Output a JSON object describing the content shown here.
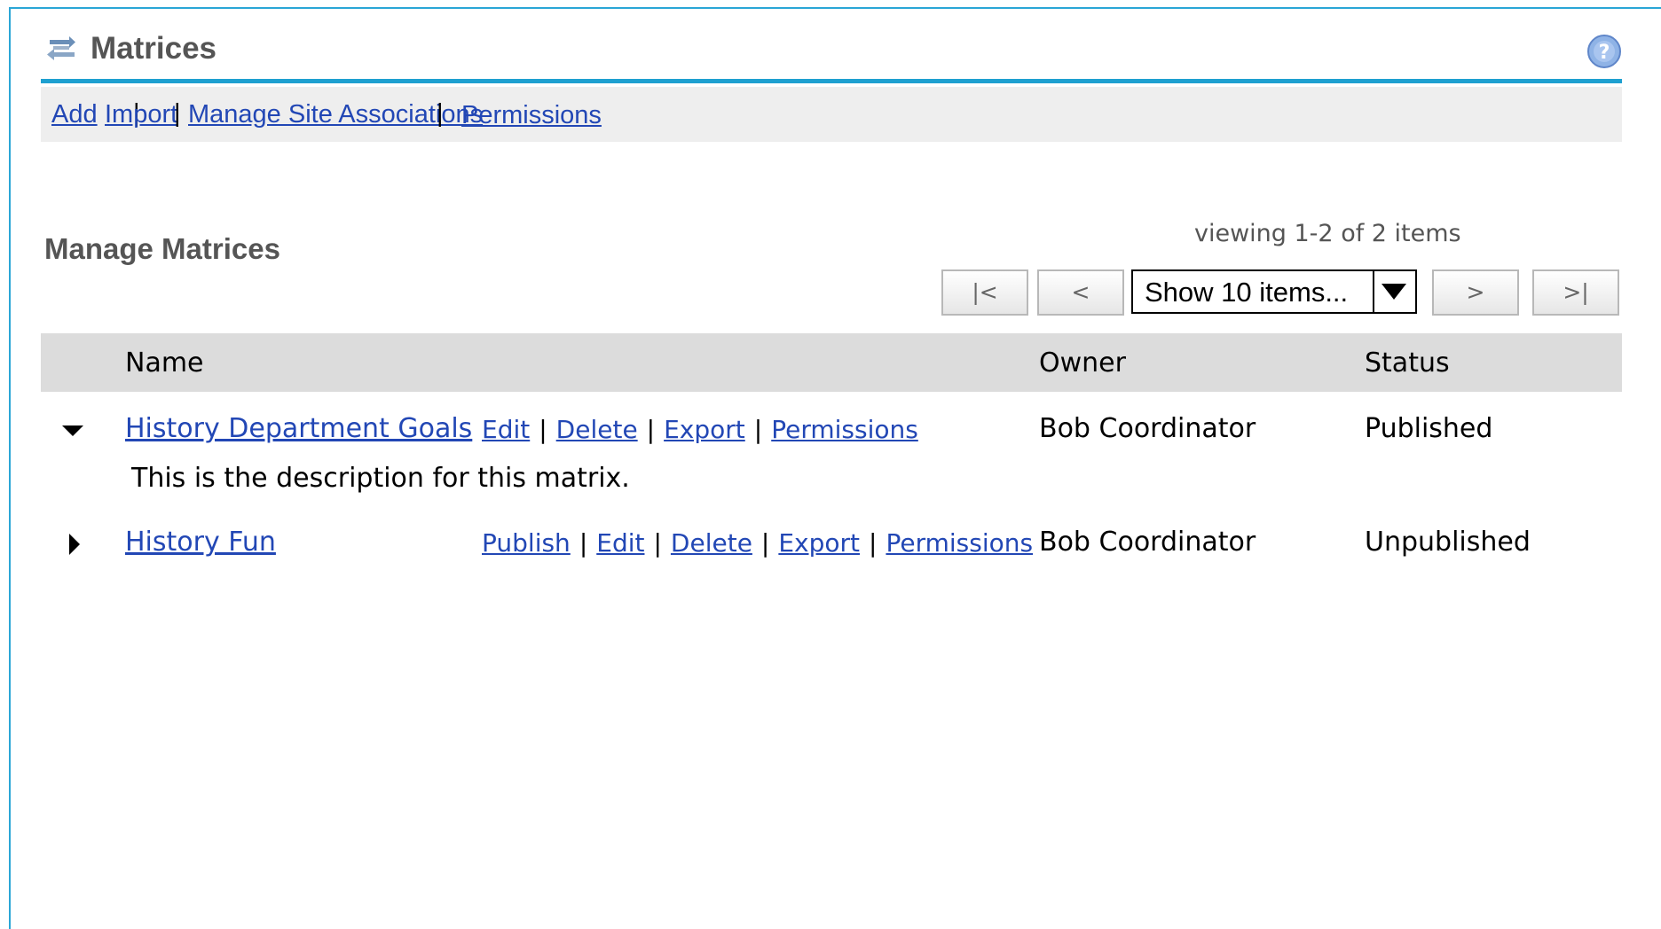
{
  "tool": {
    "title": "Matrices",
    "icon": "matrix-tool-icon",
    "help_icon": "help-icon"
  },
  "nav": {
    "links": [
      "Add",
      "Import",
      "Manage Site Associations",
      "Permissions"
    ],
    "separator": "|"
  },
  "section": {
    "title": "Manage Matrices"
  },
  "pager": {
    "viewing": "viewing 1-2 of 2 items",
    "first": "|<",
    "prev": "<",
    "next": ">",
    "last": ">|",
    "page_size": "Show 10 items..."
  },
  "table": {
    "headers": [
      "Name",
      "Owner",
      "Status"
    ],
    "rows": [
      {
        "name": "History Department Goals",
        "expanded": true,
        "actions": [
          "Edit",
          "Delete",
          "Export",
          "Permissions"
        ],
        "owner": "Bob Coordinator",
        "status": "Published",
        "description": "This is the description for this matrix."
      },
      {
        "name": "History Fun",
        "expanded": false,
        "actions": [
          "Publish",
          "Edit",
          "Delete",
          "Export",
          "Permissions"
        ],
        "owner": "Bob Coordinator",
        "status": "Unpublished"
      }
    ]
  },
  "colors": {
    "accent": "#1ea0d0",
    "link": "#2247b5",
    "header_bg": "#dcdcdc",
    "nav_bg": "#eeeeee"
  }
}
